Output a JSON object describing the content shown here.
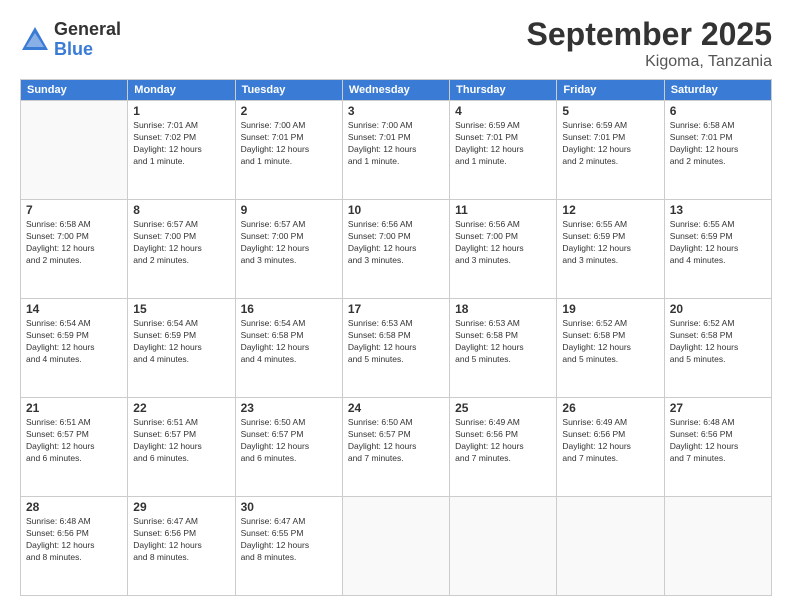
{
  "logo": {
    "general": "General",
    "blue": "Blue"
  },
  "header": {
    "title": "September 2025",
    "subtitle": "Kigoma, Tanzania"
  },
  "calendar": {
    "weekdays": [
      "Sunday",
      "Monday",
      "Tuesday",
      "Wednesday",
      "Thursday",
      "Friday",
      "Saturday"
    ],
    "weeks": [
      [
        {
          "day": "",
          "info": ""
        },
        {
          "day": "1",
          "info": "Sunrise: 7:01 AM\nSunset: 7:02 PM\nDaylight: 12 hours\nand 1 minute."
        },
        {
          "day": "2",
          "info": "Sunrise: 7:00 AM\nSunset: 7:01 PM\nDaylight: 12 hours\nand 1 minute."
        },
        {
          "day": "3",
          "info": "Sunrise: 7:00 AM\nSunset: 7:01 PM\nDaylight: 12 hours\nand 1 minute."
        },
        {
          "day": "4",
          "info": "Sunrise: 6:59 AM\nSunset: 7:01 PM\nDaylight: 12 hours\nand 1 minute."
        },
        {
          "day": "5",
          "info": "Sunrise: 6:59 AM\nSunset: 7:01 PM\nDaylight: 12 hours\nand 2 minutes."
        },
        {
          "day": "6",
          "info": "Sunrise: 6:58 AM\nSunset: 7:01 PM\nDaylight: 12 hours\nand 2 minutes."
        }
      ],
      [
        {
          "day": "7",
          "info": "Sunrise: 6:58 AM\nSunset: 7:00 PM\nDaylight: 12 hours\nand 2 minutes."
        },
        {
          "day": "8",
          "info": "Sunrise: 6:57 AM\nSunset: 7:00 PM\nDaylight: 12 hours\nand 2 minutes."
        },
        {
          "day": "9",
          "info": "Sunrise: 6:57 AM\nSunset: 7:00 PM\nDaylight: 12 hours\nand 3 minutes."
        },
        {
          "day": "10",
          "info": "Sunrise: 6:56 AM\nSunset: 7:00 PM\nDaylight: 12 hours\nand 3 minutes."
        },
        {
          "day": "11",
          "info": "Sunrise: 6:56 AM\nSunset: 7:00 PM\nDaylight: 12 hours\nand 3 minutes."
        },
        {
          "day": "12",
          "info": "Sunrise: 6:55 AM\nSunset: 6:59 PM\nDaylight: 12 hours\nand 3 minutes."
        },
        {
          "day": "13",
          "info": "Sunrise: 6:55 AM\nSunset: 6:59 PM\nDaylight: 12 hours\nand 4 minutes."
        }
      ],
      [
        {
          "day": "14",
          "info": "Sunrise: 6:54 AM\nSunset: 6:59 PM\nDaylight: 12 hours\nand 4 minutes."
        },
        {
          "day": "15",
          "info": "Sunrise: 6:54 AM\nSunset: 6:59 PM\nDaylight: 12 hours\nand 4 minutes."
        },
        {
          "day": "16",
          "info": "Sunrise: 6:54 AM\nSunset: 6:58 PM\nDaylight: 12 hours\nand 4 minutes."
        },
        {
          "day": "17",
          "info": "Sunrise: 6:53 AM\nSunset: 6:58 PM\nDaylight: 12 hours\nand 5 minutes."
        },
        {
          "day": "18",
          "info": "Sunrise: 6:53 AM\nSunset: 6:58 PM\nDaylight: 12 hours\nand 5 minutes."
        },
        {
          "day": "19",
          "info": "Sunrise: 6:52 AM\nSunset: 6:58 PM\nDaylight: 12 hours\nand 5 minutes."
        },
        {
          "day": "20",
          "info": "Sunrise: 6:52 AM\nSunset: 6:58 PM\nDaylight: 12 hours\nand 5 minutes."
        }
      ],
      [
        {
          "day": "21",
          "info": "Sunrise: 6:51 AM\nSunset: 6:57 PM\nDaylight: 12 hours\nand 6 minutes."
        },
        {
          "day": "22",
          "info": "Sunrise: 6:51 AM\nSunset: 6:57 PM\nDaylight: 12 hours\nand 6 minutes."
        },
        {
          "day": "23",
          "info": "Sunrise: 6:50 AM\nSunset: 6:57 PM\nDaylight: 12 hours\nand 6 minutes."
        },
        {
          "day": "24",
          "info": "Sunrise: 6:50 AM\nSunset: 6:57 PM\nDaylight: 12 hours\nand 7 minutes."
        },
        {
          "day": "25",
          "info": "Sunrise: 6:49 AM\nSunset: 6:56 PM\nDaylight: 12 hours\nand 7 minutes."
        },
        {
          "day": "26",
          "info": "Sunrise: 6:49 AM\nSunset: 6:56 PM\nDaylight: 12 hours\nand 7 minutes."
        },
        {
          "day": "27",
          "info": "Sunrise: 6:48 AM\nSunset: 6:56 PM\nDaylight: 12 hours\nand 7 minutes."
        }
      ],
      [
        {
          "day": "28",
          "info": "Sunrise: 6:48 AM\nSunset: 6:56 PM\nDaylight: 12 hours\nand 8 minutes."
        },
        {
          "day": "29",
          "info": "Sunrise: 6:47 AM\nSunset: 6:56 PM\nDaylight: 12 hours\nand 8 minutes."
        },
        {
          "day": "30",
          "info": "Sunrise: 6:47 AM\nSunset: 6:55 PM\nDaylight: 12 hours\nand 8 minutes."
        },
        {
          "day": "",
          "info": ""
        },
        {
          "day": "",
          "info": ""
        },
        {
          "day": "",
          "info": ""
        },
        {
          "day": "",
          "info": ""
        }
      ]
    ]
  }
}
